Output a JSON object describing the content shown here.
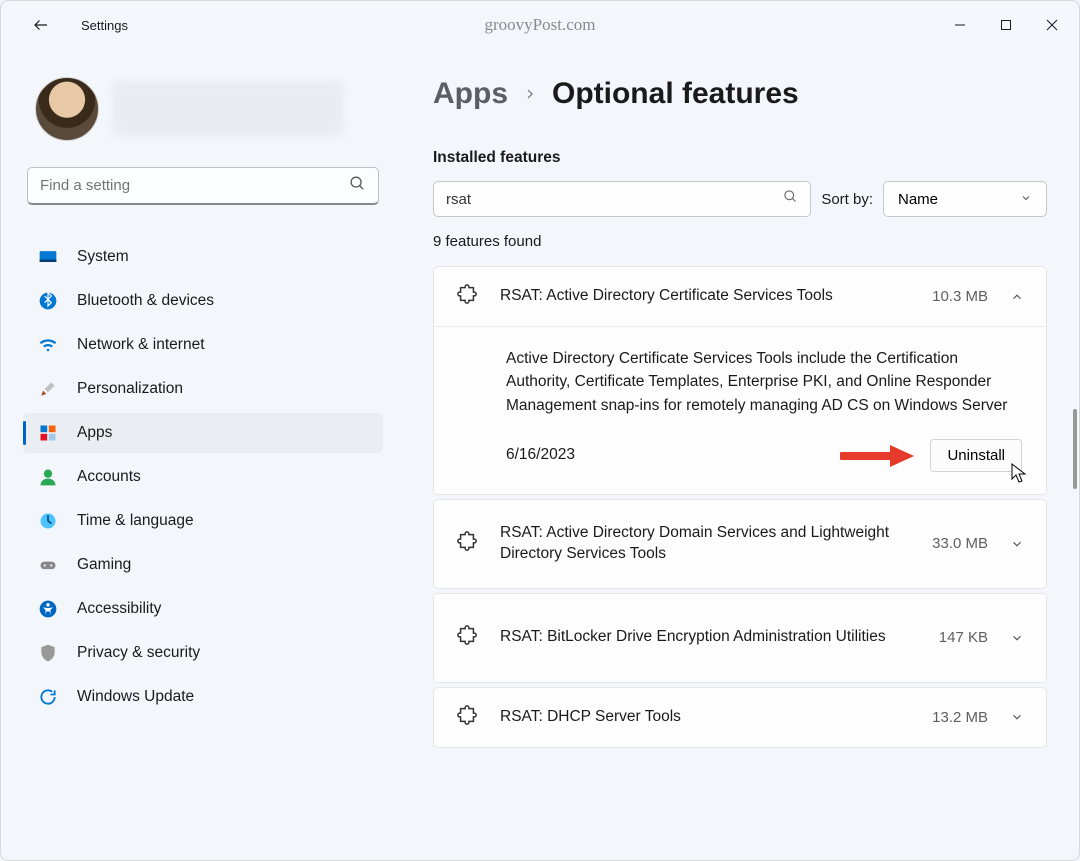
{
  "window": {
    "title": "Settings",
    "watermark": "groovyPost.com"
  },
  "sidebar": {
    "search_placeholder": "Find a setting",
    "items": [
      {
        "label": "System"
      },
      {
        "label": "Bluetooth & devices"
      },
      {
        "label": "Network & internet"
      },
      {
        "label": "Personalization"
      },
      {
        "label": "Apps"
      },
      {
        "label": "Accounts"
      },
      {
        "label": "Time & language"
      },
      {
        "label": "Gaming"
      },
      {
        "label": "Accessibility"
      },
      {
        "label": "Privacy & security"
      },
      {
        "label": "Windows Update"
      }
    ],
    "selected_index": 4
  },
  "breadcrumb": {
    "parent": "Apps",
    "current": "Optional features"
  },
  "main": {
    "section_title": "Installed features",
    "search_value": "rsat",
    "sort_label": "Sort by:",
    "sort_value": "Name",
    "results_text": "9 features found",
    "uninstall_label": "Uninstall",
    "features": [
      {
        "title": "RSAT: Active Directory Certificate Services Tools",
        "size": "10.3 MB",
        "expanded": true,
        "description": "Active Directory Certificate Services Tools include the Certification Authority, Certificate Templates, Enterprise PKI, and Online Responder Management snap-ins for remotely managing AD CS on Windows Server",
        "date": "6/16/2023"
      },
      {
        "title": "RSAT: Active Directory Domain Services and Lightweight Directory Services Tools",
        "size": "33.0 MB",
        "expanded": false
      },
      {
        "title": "RSAT: BitLocker Drive Encryption Administration Utilities",
        "size": "147 KB",
        "expanded": false
      },
      {
        "title": "RSAT: DHCP Server Tools",
        "size": "13.2 MB",
        "expanded": false
      }
    ]
  }
}
